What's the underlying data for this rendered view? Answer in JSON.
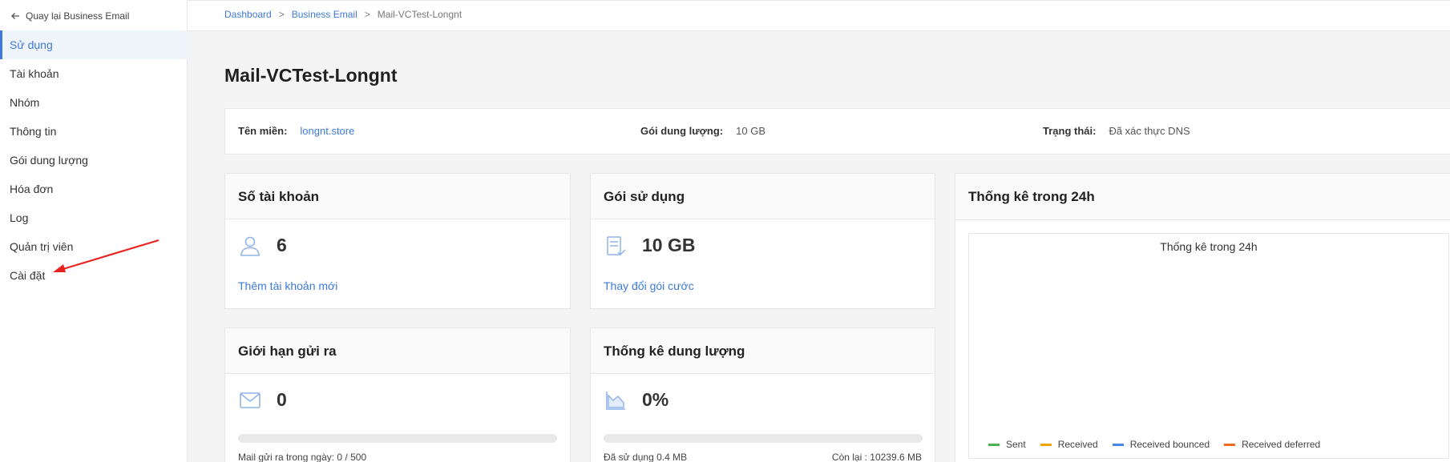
{
  "sidebar": {
    "back_label": "Quay lại Business Email",
    "items": [
      {
        "label": "Sử dụng",
        "active": true
      },
      {
        "label": "Tài khoản"
      },
      {
        "label": "Nhóm"
      },
      {
        "label": "Thông tin"
      },
      {
        "label": "Gói dung lượng"
      },
      {
        "label": "Hóa đơn"
      },
      {
        "label": "Log"
      },
      {
        "label": "Quản trị viên"
      },
      {
        "label": "Cài đặt"
      }
    ]
  },
  "breadcrumb": {
    "items": [
      "Dashboard",
      "Business Email",
      "Mail-VCTest-Longnt"
    ],
    "separator": ">"
  },
  "page": {
    "title": "Mail-VCTest-Longnt"
  },
  "info": {
    "domain_label": "Tên miền:",
    "domain_value": "longnt.store",
    "package_label": "Gói dung lượng:",
    "package_value": "10 GB",
    "status_label": "Trạng thái:",
    "status_value": "Đã xác thực DNS"
  },
  "cards": {
    "accounts": {
      "title": "Số tài khoản",
      "value": "6",
      "link": "Thêm tài khoản mới",
      "icon": "user-icon"
    },
    "usage_package": {
      "title": "Gói sử dụng",
      "value": "10 GB",
      "link": "Thay đổi gói cước",
      "icon": "storage-icon"
    },
    "send_limit": {
      "title": "Giới hạn gửi ra",
      "value": "0",
      "icon": "mail-icon",
      "progress": 0,
      "footer": "Mail gửi ra trong ngày: 0 / 500"
    },
    "storage_stats": {
      "title": "Thống kê dung lượng",
      "value": "0%",
      "icon": "area-chart-icon",
      "progress": 0,
      "used": "Đã sử dụng 0.4 MB",
      "remaining": "Còn lại : 10239.6 MB"
    },
    "stats24h": {
      "title": "Thống kê trong 24h"
    }
  },
  "chart_data": {
    "type": "line",
    "title": "Thống kê trong 24h",
    "series": [
      {
        "name": "Sent",
        "color": "#4caf50",
        "values": []
      },
      {
        "name": "Received",
        "color": "#f0a500",
        "values": []
      },
      {
        "name": "Received bounced",
        "color": "#4a86e8",
        "values": []
      },
      {
        "name": "Received deferred",
        "color": "#f06a1a",
        "values": []
      }
    ],
    "legend": "bottom"
  },
  "colors": {
    "accent": "#3f7ad8",
    "annotation_arrow": "#e8231f"
  }
}
